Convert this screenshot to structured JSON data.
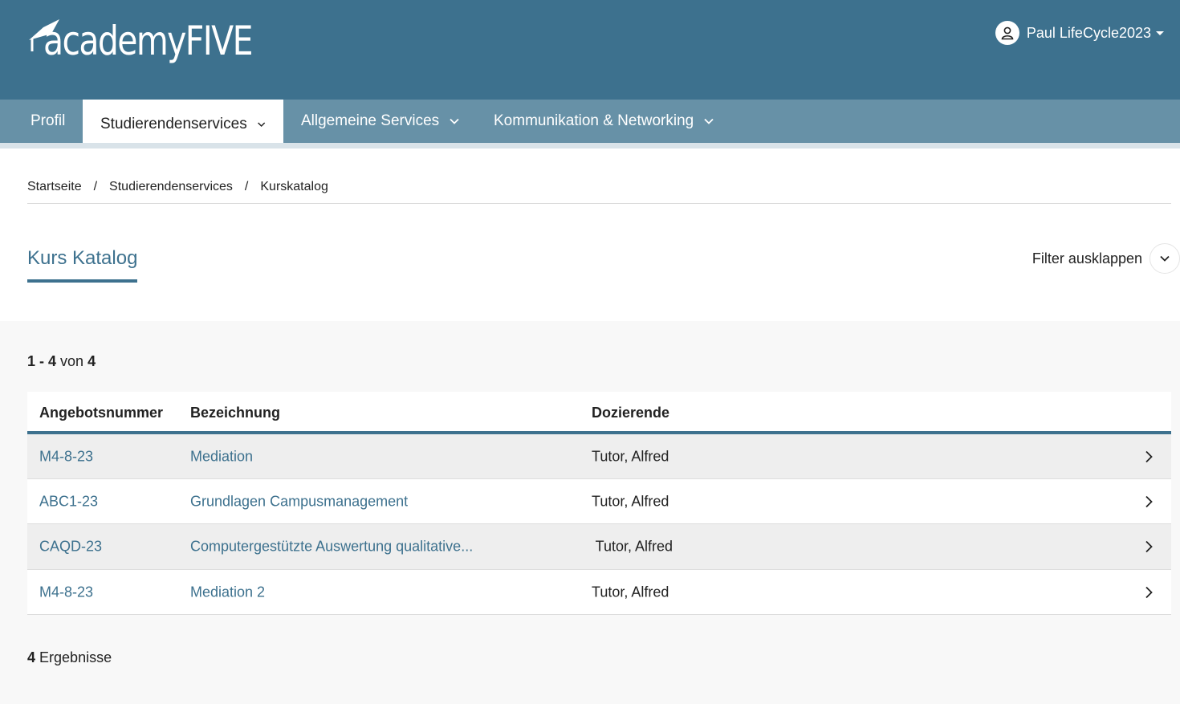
{
  "header": {
    "logo_text": "academyFIVE",
    "user_name": "Paul LifeCycle2023",
    "icons": {
      "logo": "graduation-cap-icon",
      "user": "user-icon",
      "caret": "caret-down-icon"
    }
  },
  "nav": {
    "items": [
      {
        "label": "Profil",
        "has_dropdown": false,
        "active": false
      },
      {
        "label": "Studierendenservices",
        "has_dropdown": true,
        "active": true
      },
      {
        "label": "Allgemeine Services",
        "has_dropdown": true,
        "active": false
      },
      {
        "label": "Kommunikation & Networking",
        "has_dropdown": true,
        "active": false
      }
    ]
  },
  "breadcrumb": {
    "items": [
      "Startseite",
      "Studierendenservices",
      "Kurskatalog"
    ],
    "separator": "/"
  },
  "page": {
    "title": "Kurs Katalog",
    "filter_label": "Filter ausklappen"
  },
  "listing": {
    "range": "1 - 4",
    "of_label": "von",
    "total": "4",
    "results_count": "4",
    "results_label": "Ergebnisse"
  },
  "table": {
    "columns": [
      "Angebotsnummer",
      "Bezeichnung",
      "Dozierende"
    ],
    "rows": [
      {
        "number": "M4-8-23",
        "name": "Mediation",
        "lecturer": "Tutor, Alfred"
      },
      {
        "number": "ABC1-23",
        "name": "Grundlagen Campusmanagement",
        "lecturer": "Tutor, Alfred"
      },
      {
        "number": "CAQD-23",
        "name": "Computergestützte Auswertung qualitative...",
        "lecturer": " Tutor, Alfred"
      },
      {
        "number": "M4-8-23",
        "name": "Mediation 2",
        "lecturer": "Tutor, Alfred"
      }
    ]
  },
  "colors": {
    "brand": "#3d718e",
    "nav": "#6791a7",
    "row_shade": "#eeeeee",
    "content_bg": "#f8f8f8"
  }
}
